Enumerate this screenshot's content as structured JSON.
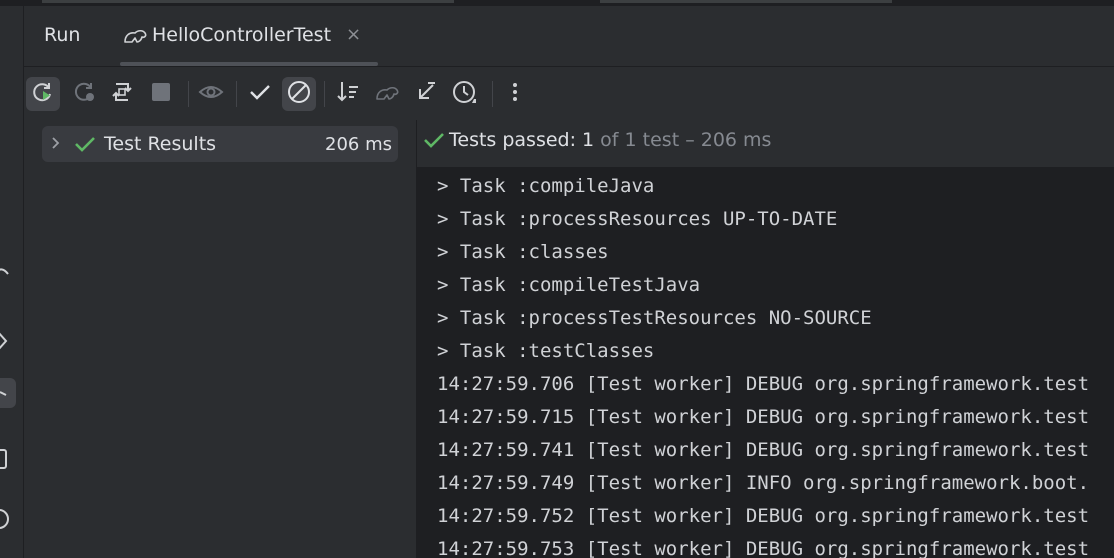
{
  "panel": {
    "title": "Run",
    "tab": {
      "label": "HelloControllerTest",
      "close": "×"
    }
  },
  "toolbar": {
    "buttons": [
      "rerun-icon",
      "rerun-failed-icon",
      "toggle-auto-test-icon",
      "stop-icon",
      "show-passed-icon",
      "show-ignored-icon",
      "sort-icon",
      "import-tests-icon",
      "export-tests-icon",
      "history-icon",
      "more-icon"
    ]
  },
  "tree": {
    "root": {
      "label": "Test Results",
      "duration": "206 ms"
    }
  },
  "status": {
    "prefix": "Tests passed: ",
    "passed": "1",
    "rest": " of 1 test – 206 ms"
  },
  "console": {
    "lines": [
      "> Task :compileJava",
      "> Task :processResources UP-TO-DATE",
      "> Task :classes",
      "> Task :compileTestJava",
      "> Task :processTestResources NO-SOURCE",
      "> Task :testClasses",
      "14:27:59.706 [Test worker] DEBUG org.springframework.test",
      "14:27:59.715 [Test worker] DEBUG org.springframework.test",
      "14:27:59.741 [Test worker] DEBUG org.springframework.test",
      "14:27:59.749 [Test worker] INFO org.springframework.boot.",
      "14:27:59.752 [Test worker] DEBUG org.springframework.test",
      "14:27:59.753 [Test worker] DEBUG org.springframework.test"
    ]
  },
  "colors": {
    "background": "#2b2d30",
    "console_bg": "#1e1f22",
    "success_green": "#5fb865",
    "text": "#dfe1e5",
    "muted": "#868a91"
  }
}
